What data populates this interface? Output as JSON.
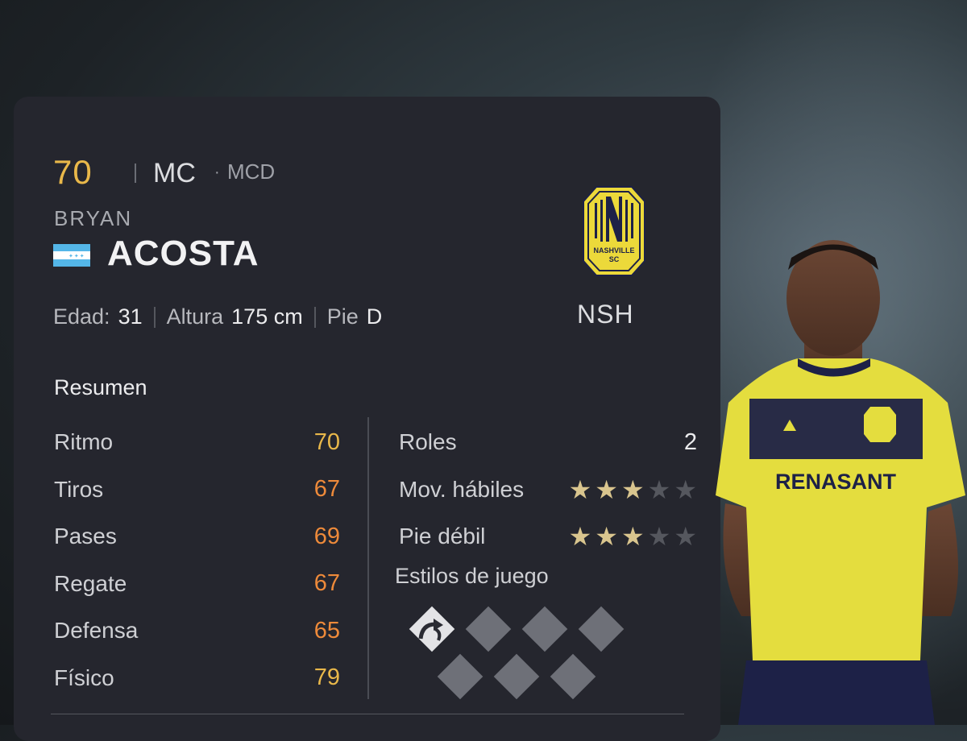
{
  "player": {
    "rating": "70",
    "position": "MC",
    "alt_position": "MCD",
    "first_name": "BRYAN",
    "last_name": "ACOSTA",
    "nationality_flag": "honduras-flag"
  },
  "info": {
    "age_label": "Edad:",
    "age": "31",
    "height_label": "Altura",
    "height": "175 cm",
    "foot_label": "Pie",
    "foot": "D"
  },
  "club": {
    "badge_text": "NASHVILLE SC",
    "badge_line1": "NASHVILLE",
    "badge_line2": "SC",
    "code": "NSH"
  },
  "summary": {
    "title": "Resumen",
    "stats": [
      {
        "name": "Ritmo",
        "value": "70",
        "color": "#e9b84a"
      },
      {
        "name": "Tiros",
        "value": "67",
        "color": "#ee8a3a"
      },
      {
        "name": "Pases",
        "value": "69",
        "color": "#ee8a3a"
      },
      {
        "name": "Regate",
        "value": "67",
        "color": "#ee8a3a"
      },
      {
        "name": "Defensa",
        "value": "65",
        "color": "#ee8a3a"
      },
      {
        "name": "Físico",
        "value": "79",
        "color": "#e9b84a"
      }
    ]
  },
  "extras": {
    "roles_label": "Roles",
    "roles_value": "2",
    "skill_moves_label": "Mov. hábiles",
    "skill_moves_stars": 3,
    "weak_foot_label": "Pie débil",
    "weak_foot_stars": 3,
    "max_stars": 5,
    "playstyles_label": "Estilos de juego",
    "playstyles_filled": 1,
    "playstyles_total": 7
  },
  "colors": {
    "gold": "#e9b84a",
    "orange": "#ee8a3a",
    "star_on": "#d9c58e",
    "star_off": "#55575e",
    "panel": "#25262e"
  }
}
